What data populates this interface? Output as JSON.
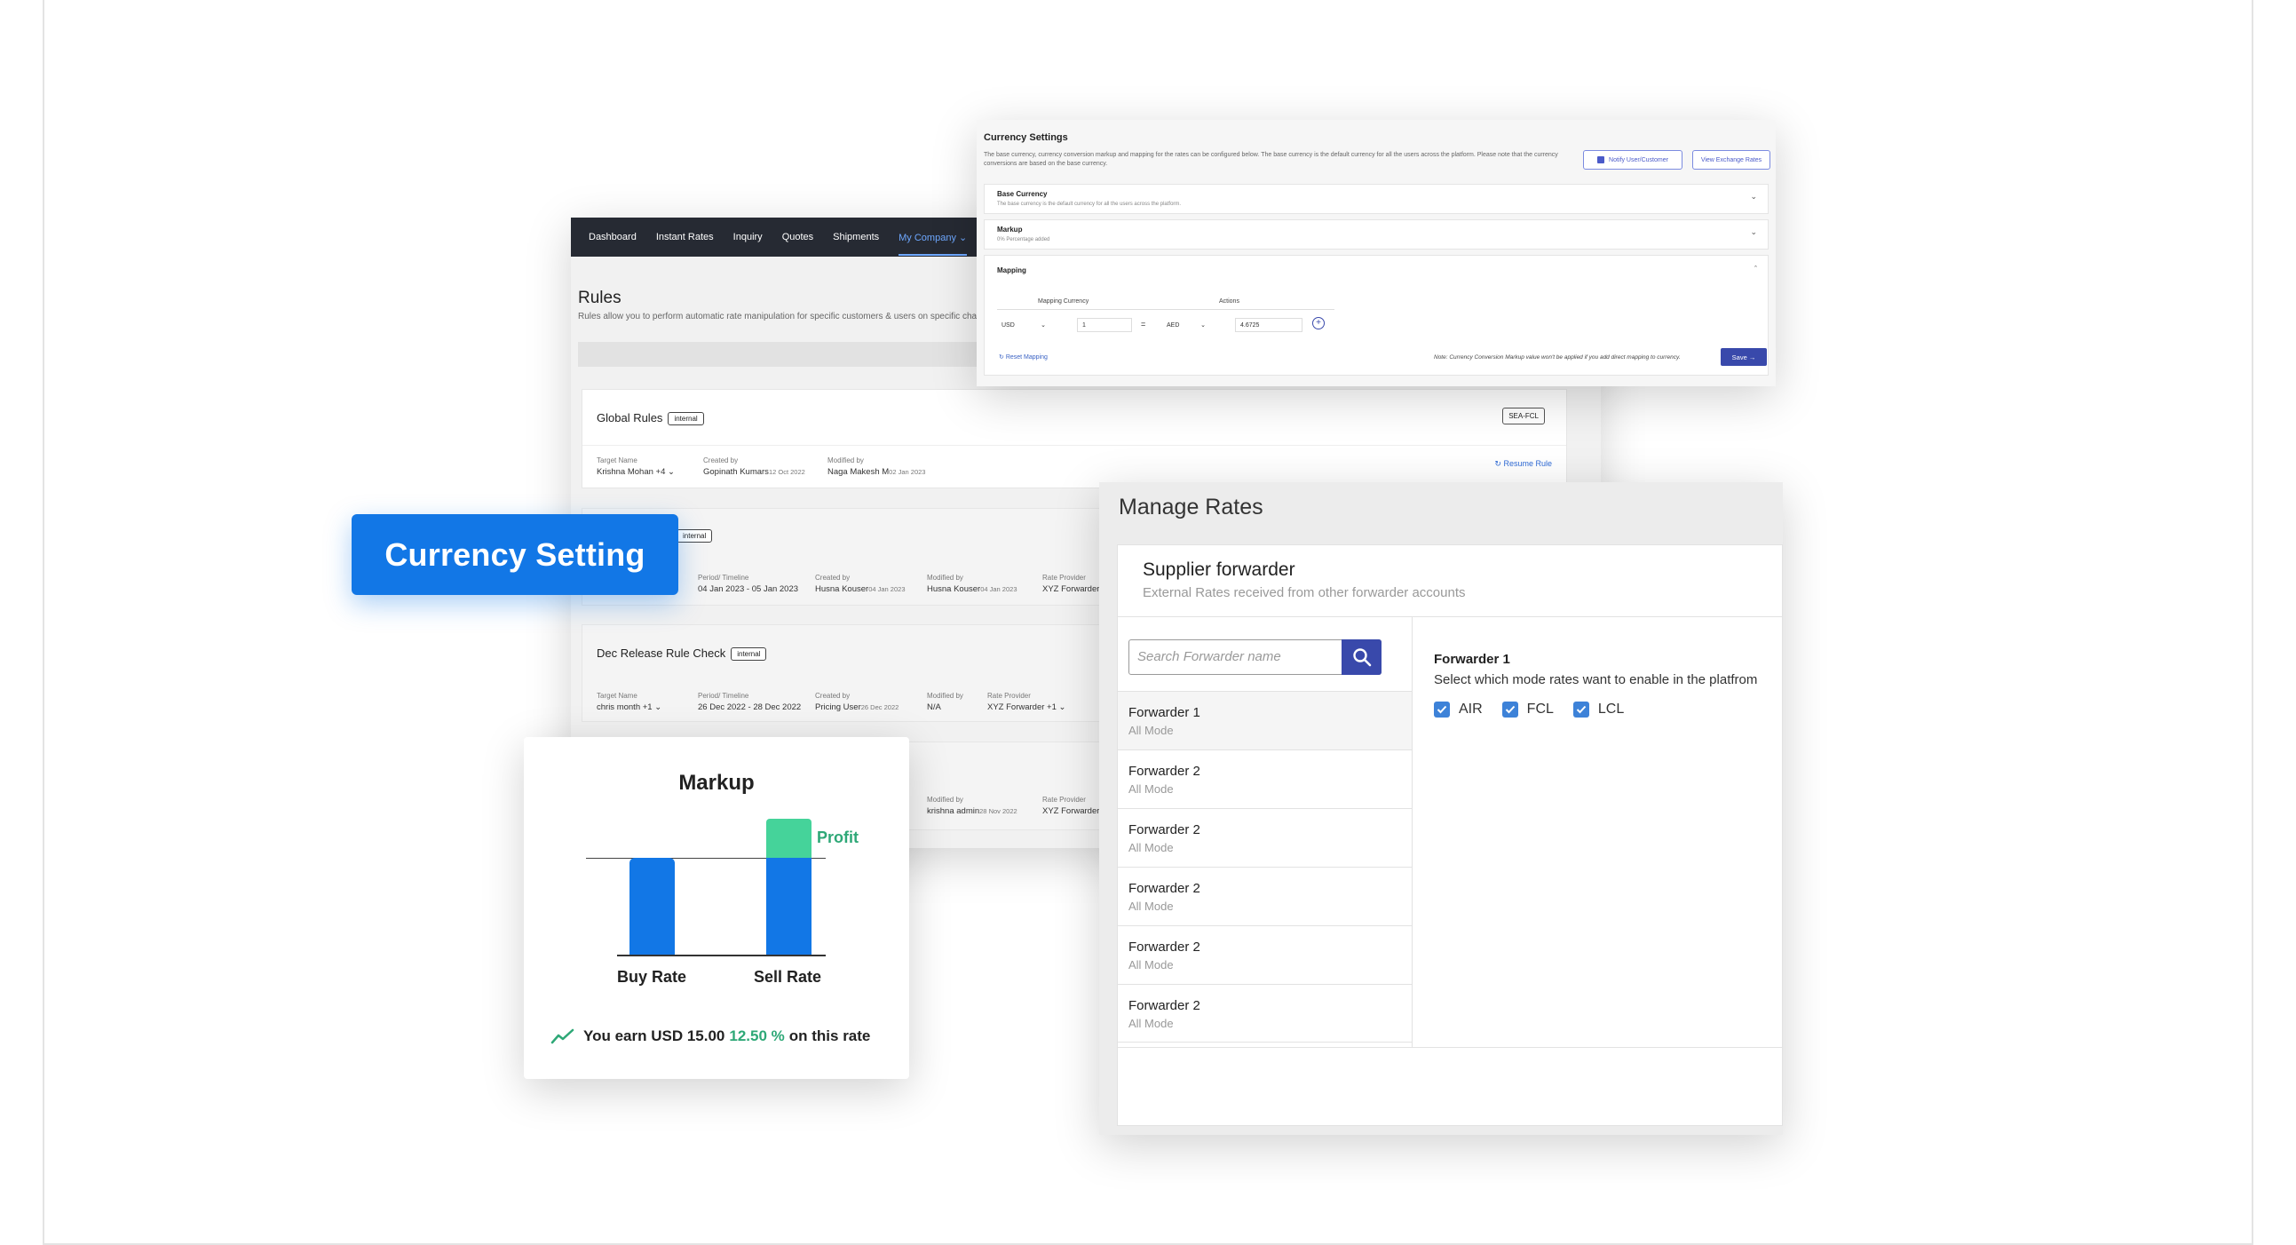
{
  "rules_app": {
    "nav": [
      "Dashboard",
      "Instant Rates",
      "Inquiry",
      "Quotes",
      "Shipments",
      "My Company"
    ],
    "title": "Rules",
    "subtitle": "Rules allow you to perform automatic rate manipulation for specific customers & users on specific cha",
    "cards": [
      {
        "name": "Global Rules",
        "tag": "internal",
        "mode": "SEA-FCL",
        "action": "Resume Rule",
        "cols": [
          {
            "label": "Target Name",
            "value": "Krishna Mohan +4",
            "date": ""
          },
          {
            "label": "Created by",
            "value": "Gopinath Kumars",
            "date": "12 Oct 2022"
          },
          {
            "label": "Modified by",
            "value": "Naga Makesh M",
            "date": "02 Jan 2023"
          }
        ]
      },
      {
        "name": "",
        "tag": "internal",
        "cols": [
          {
            "label": "Period/ Timeline",
            "value": "04 Jan 2023 - 05 Jan 2023",
            "date": ""
          },
          {
            "label": "Created by",
            "value": "Husna Kouser",
            "date": "04 Jan 2023"
          },
          {
            "label": "Modified by",
            "value": "Husna Kouser",
            "date": "04 Jan 2023"
          },
          {
            "label": "Rate Provider",
            "value": "XYZ Forwarder",
            "date": ""
          }
        ]
      },
      {
        "name": "Dec Release Rule Check",
        "tag": "internal",
        "cols": [
          {
            "label": "Target Name",
            "value": "chris month +1",
            "date": ""
          },
          {
            "label": "Period/ Timeline",
            "value": "26 Dec 2022 - 28 Dec 2022",
            "date": ""
          },
          {
            "label": "Created by",
            "value": "Pricing User",
            "date": "26 Dec 2022"
          },
          {
            "label": "Modified by",
            "value": "N/A",
            "date": ""
          },
          {
            "label": "Rate Provider",
            "value": "XYZ Forwarder +1",
            "date": ""
          }
        ]
      },
      {
        "name": "",
        "tag": "",
        "cols": [
          {
            "label": "Modified by",
            "value": "krishna admin",
            "date": "28 Nov 2022"
          },
          {
            "label": "Rate Provider",
            "value": "XYZ Forwarder",
            "date": ""
          }
        ]
      }
    ]
  },
  "currency_settings": {
    "title": "Currency Settings",
    "description": "The base currency, currency conversion markup and mapping for the rates can be configured below. The base currency is the default currency for all the users across the platform. Please note that the currency conversions are based on the base currency.",
    "notify_button": "Notify User/Customer",
    "view_button": "View Exchange Rates",
    "base_currency": {
      "title": "Base Currency",
      "subtitle": "The base currency is the default currency for all the users across the platform."
    },
    "markup": {
      "title": "Markup",
      "subtitle": "0% Percentage added"
    },
    "mapping": {
      "title": "Mapping",
      "col_currency": "Mapping Currency",
      "col_actions": "Actions",
      "from_currency": "USD",
      "from_amount": "1",
      "equals": "=",
      "to_currency": "AED",
      "to_amount": "4.6725",
      "reset_label": "Reset Mapping",
      "note": "Note: Currency Conversion Markup value won't be applied if you add direct mapping to currency.",
      "save_label": "Save"
    }
  },
  "badge": {
    "label": "Currency Setting"
  },
  "markup_card": {
    "title": "Markup",
    "buy_label": "Buy Rate",
    "sell_label": "Sell Rate",
    "profit_label": "Profit",
    "earn_prefix": "You earn USD 15.00",
    "earn_percent": "12.50 %",
    "earn_suffix": "on this rate",
    "colors": {
      "bar": "#1277e6",
      "profit": "#45d39a",
      "accent": "#2ea877"
    }
  },
  "manage_rates": {
    "title": "Manage Rates",
    "section_title": "Supplier forwarder",
    "section_subtitle": "External Rates received from other forwarder accounts",
    "search_placeholder": "Search Forwarder name",
    "forwarders": [
      {
        "name": "Forwarder 1",
        "mode": "All Mode"
      },
      {
        "name": "Forwarder 2",
        "mode": "All Mode"
      },
      {
        "name": "Forwarder 2",
        "mode": "All Mode"
      },
      {
        "name": "Forwarder 2",
        "mode": "All Mode"
      },
      {
        "name": "Forwarder 2",
        "mode": "All Mode"
      },
      {
        "name": "Forwarder 2",
        "mode": "All Mode"
      }
    ],
    "detail": {
      "name": "Forwarder 1",
      "description": "Select which mode rates want to enable in the platfrom",
      "modes": [
        "AIR",
        "FCL",
        "LCL"
      ]
    }
  }
}
